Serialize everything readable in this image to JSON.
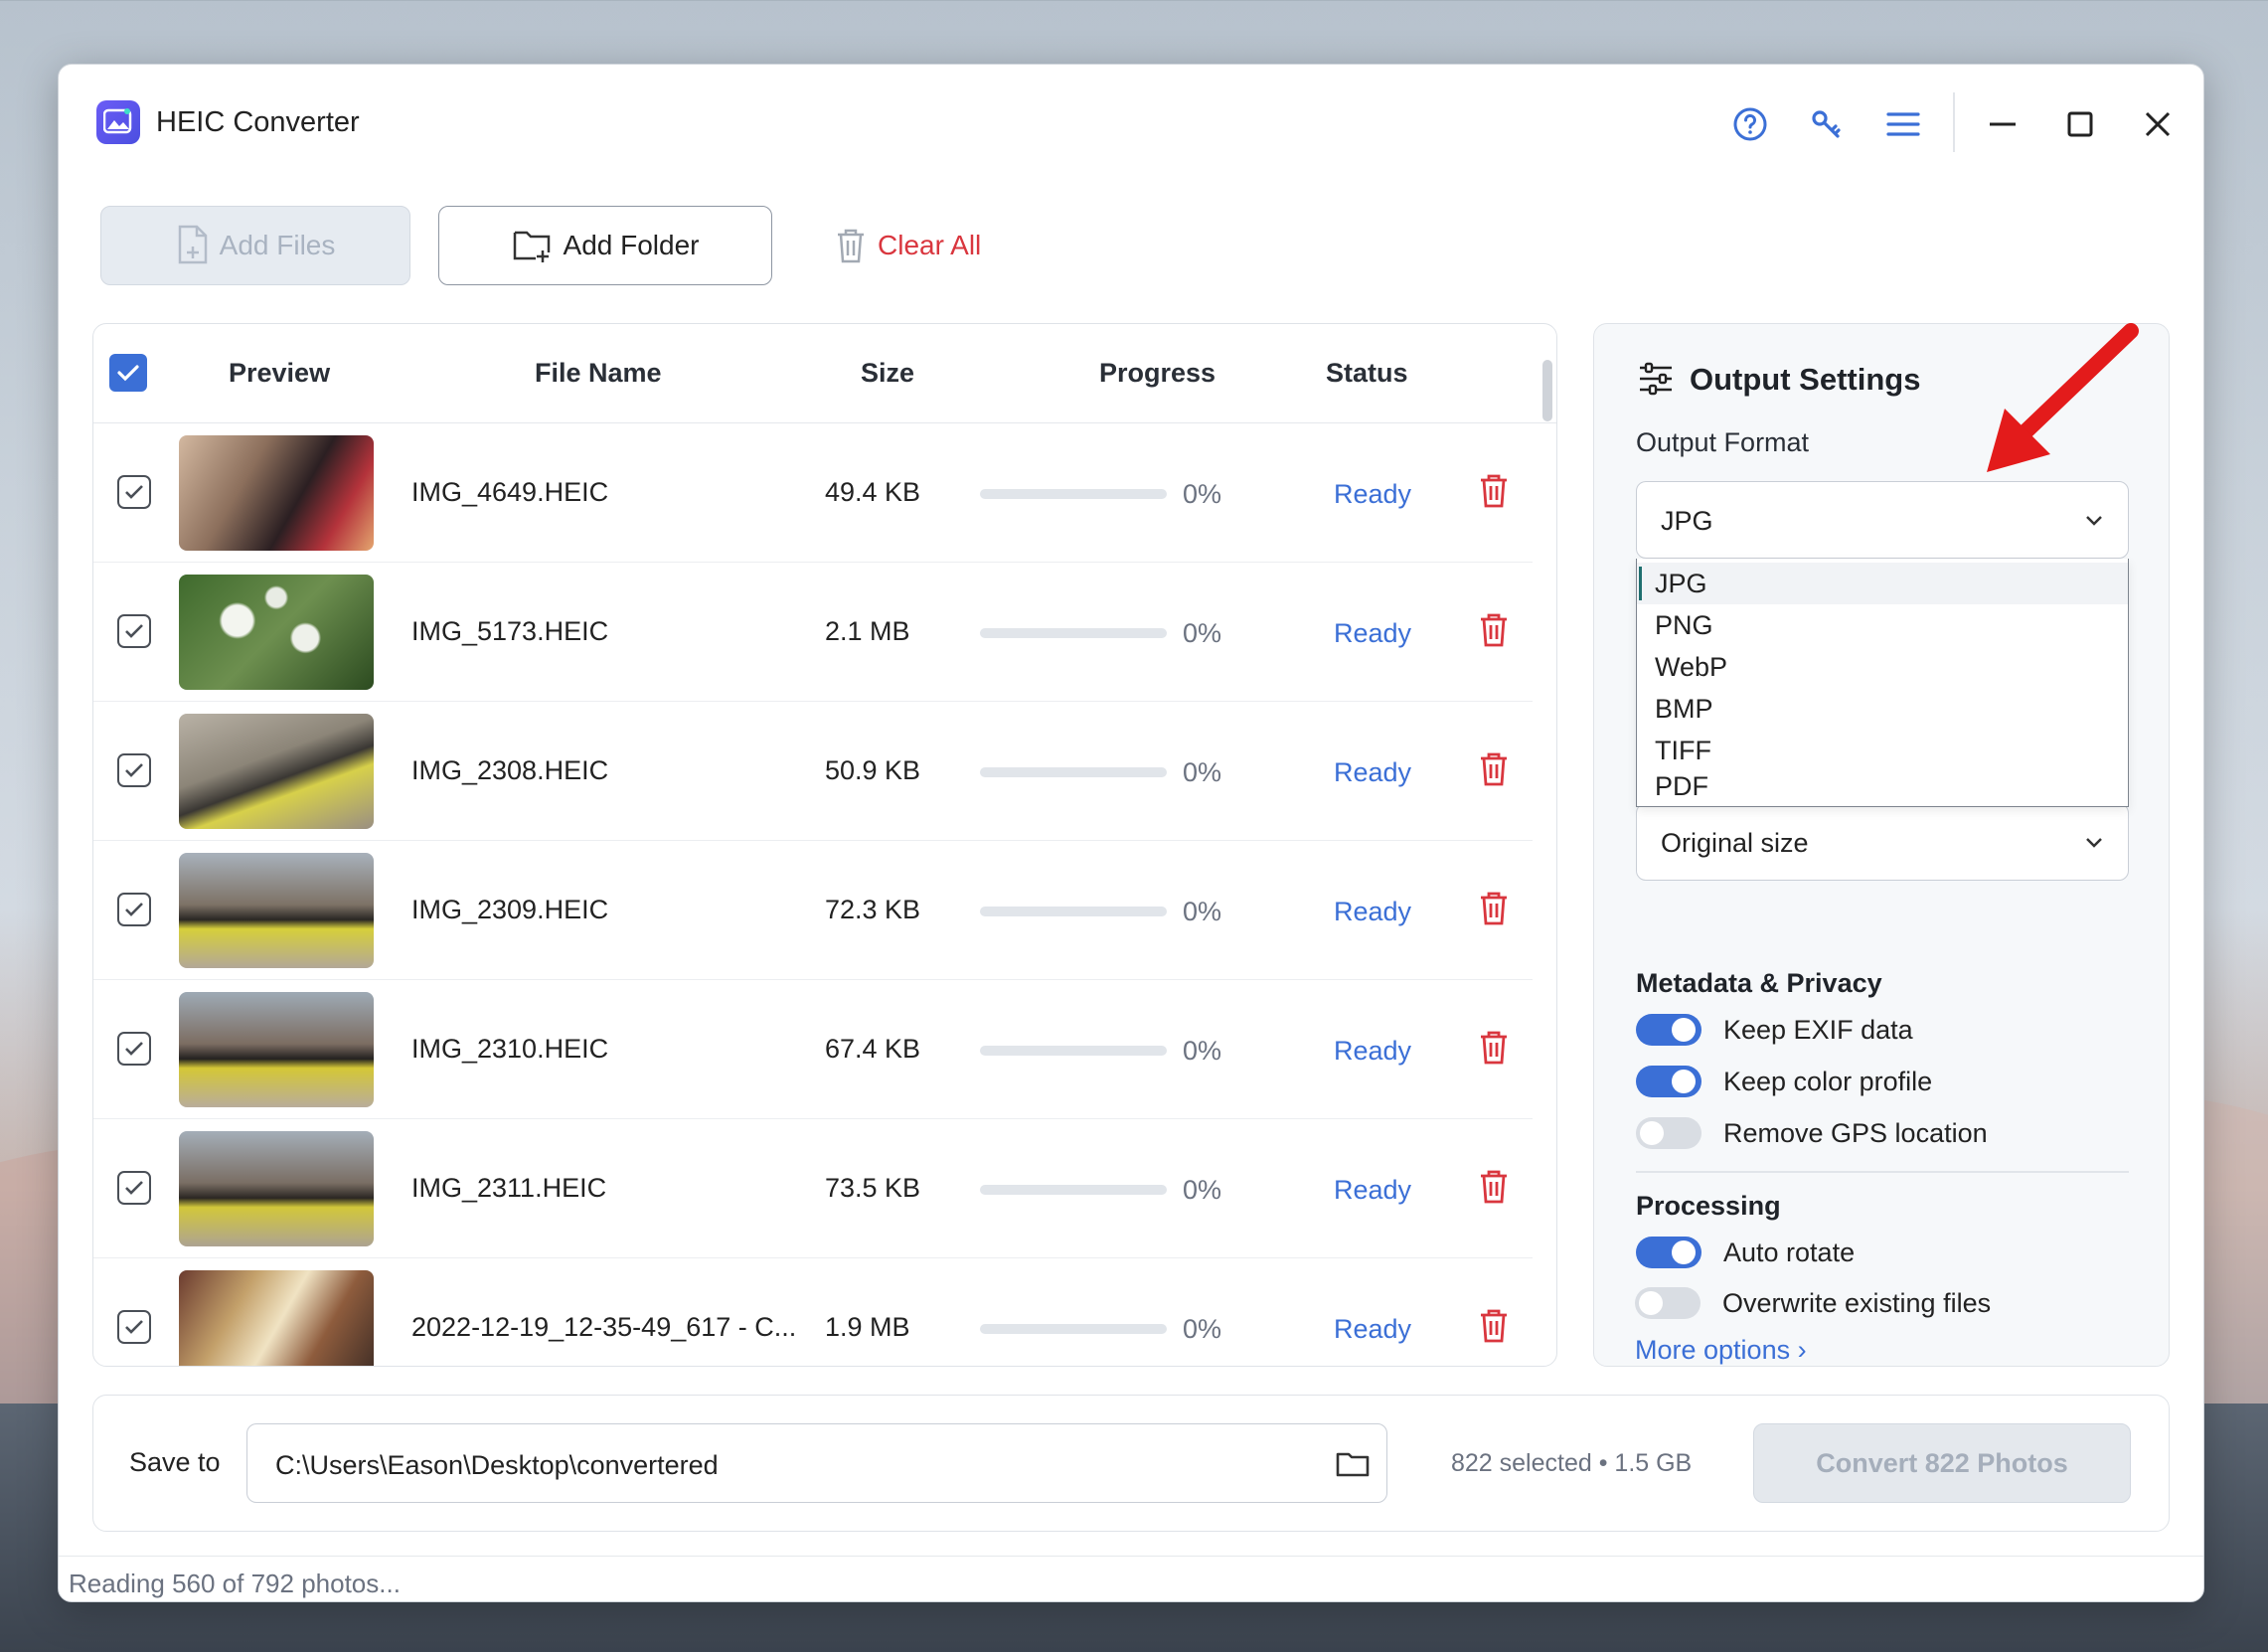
{
  "app": {
    "title": "HEIC Converter"
  },
  "toolbar": {
    "add_files": "Add Files",
    "add_folder": "Add Folder",
    "clear_all": "Clear All"
  },
  "list": {
    "headers": {
      "preview": "Preview",
      "file_name": "File Name",
      "size": "Size",
      "progress": "Progress",
      "status": "Status"
    },
    "rows": [
      {
        "name": "IMG_4649.HEIC",
        "size": "49.4 KB",
        "progress": 0,
        "pct": "0%",
        "status": "Ready"
      },
      {
        "name": "IMG_5173.HEIC",
        "size": "2.1 MB",
        "progress": 0,
        "pct": "0%",
        "status": "Ready"
      },
      {
        "name": "IMG_2308.HEIC",
        "size": "50.9 KB",
        "progress": 0,
        "pct": "0%",
        "status": "Ready"
      },
      {
        "name": "IMG_2309.HEIC",
        "size": "72.3 KB",
        "progress": 0,
        "pct": "0%",
        "status": "Ready"
      },
      {
        "name": "IMG_2310.HEIC",
        "size": "67.4 KB",
        "progress": 0,
        "pct": "0%",
        "status": "Ready"
      },
      {
        "name": "IMG_2311.HEIC",
        "size": "73.5 KB",
        "progress": 0,
        "pct": "0%",
        "status": "Ready"
      },
      {
        "name": "2022-12-19_12-35-49_617 - C...",
        "size": "1.9 MB",
        "progress": 0,
        "pct": "0%",
        "status": "Ready"
      }
    ]
  },
  "settings": {
    "title": "Output Settings",
    "output_format_label": "Output Format",
    "output_format_value": "JPG",
    "format_options": [
      "JPG",
      "PNG",
      "WebP",
      "BMP",
      "TIFF",
      "PDF"
    ],
    "size_value": "Original size",
    "metadata_heading": "Metadata & Privacy",
    "keep_exif": {
      "label": "Keep EXIF data",
      "on": true
    },
    "keep_color": {
      "label": "Keep color profile",
      "on": true
    },
    "remove_gps": {
      "label": "Remove GPS location",
      "on": false
    },
    "processing_heading": "Processing",
    "auto_rotate": {
      "label": "Auto rotate",
      "on": true
    },
    "overwrite": {
      "label": "Overwrite existing files",
      "on": false
    },
    "more_options": "More options ›"
  },
  "bottom": {
    "save_to_label": "Save to",
    "save_path": "C:\\Users\\Eason\\Desktop\\convertered",
    "selection_info": "822 selected • 1.5 GB",
    "convert_button": "Convert 822 Photos"
  },
  "statusbar": {
    "text": "Reading 560 of 792 photos..."
  },
  "colors": {
    "accent": "#3b6fd6",
    "danger": "#d9363e",
    "annotation": "#e31b1b"
  }
}
